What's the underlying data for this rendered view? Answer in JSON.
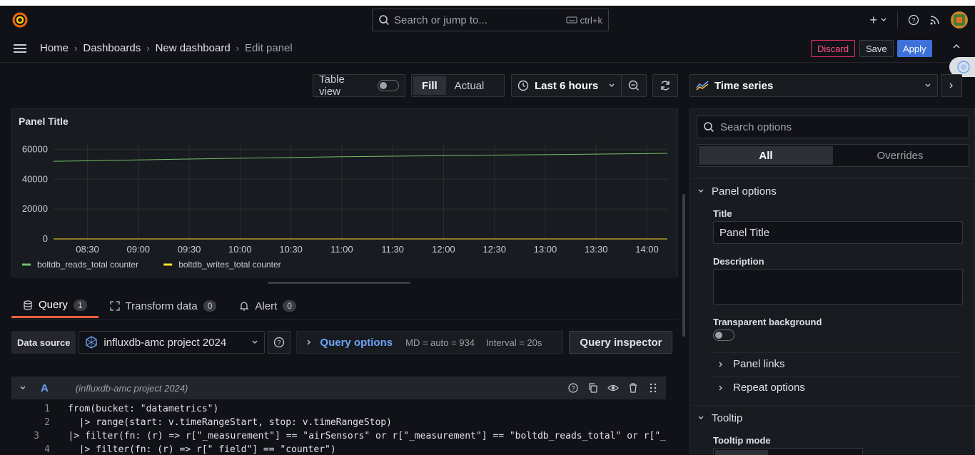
{
  "topbar": {
    "search_placeholder": "Search or jump to...",
    "search_shortcut": "ctrl+k"
  },
  "breadcrumb": {
    "items": [
      "Home",
      "Dashboards",
      "New dashboard"
    ],
    "current": "Edit panel"
  },
  "actions": {
    "discard": "Discard",
    "save": "Save",
    "apply": "Apply"
  },
  "toolbar": {
    "table_view": "Table view",
    "fill": "Fill",
    "actual": "Actual",
    "time_range": "Last 6 hours"
  },
  "panel": {
    "title": "Panel Title"
  },
  "chart_data": {
    "type": "line",
    "title": "Panel Title",
    "x_ticks": [
      "08:30",
      "09:00",
      "09:30",
      "10:00",
      "10:30",
      "11:00",
      "11:30",
      "12:00",
      "12:30",
      "13:00",
      "13:30",
      "14:00"
    ],
    "y_ticks": [
      "0",
      "20000",
      "40000",
      "60000"
    ],
    "ylim": [
      0,
      64000
    ],
    "grid": true,
    "legend_position": "bottom-left",
    "series": [
      {
        "name": "boltdb_reads_total counter",
        "color": "#73bf69",
        "x": [
          "08:10",
          "08:30",
          "09:00",
          "09:30",
          "10:00",
          "10:30",
          "11:00",
          "11:30",
          "12:00",
          "12:30",
          "13:00",
          "13:30",
          "14:00",
          "14:12"
        ],
        "values": [
          52000,
          52300,
          52900,
          53500,
          54000,
          54500,
          55000,
          55400,
          55800,
          56100,
          56400,
          56800,
          57100,
          57300
        ]
      },
      {
        "name": "boltdb_writes_total counter",
        "color": "#fade2a",
        "x": [
          "08:10",
          "14:12"
        ],
        "values": [
          0,
          0
        ]
      }
    ]
  },
  "query_tabs": [
    {
      "label": "Query",
      "count": "1"
    },
    {
      "label": "Transform data",
      "count": "0"
    },
    {
      "label": "Alert",
      "count": "0"
    }
  ],
  "datasource": {
    "label": "Data source",
    "value": "influxdb-amc project 2024",
    "query_options": "Query options",
    "md": "MD = auto = 934",
    "interval": "Interval = 20s",
    "inspector": "Query inspector"
  },
  "query": {
    "ref": "A",
    "source": "(influxdb-amc project 2024)",
    "lines": [
      {
        "n": "1",
        "text": "from(bucket: \"datametrics\")"
      },
      {
        "n": "2",
        "text": "  |> range(start: v.timeRangeStart, stop: v.timeRangeStop)"
      },
      {
        "n": "3",
        "text": "  |> filter(fn: (r) => r[\"_measurement\"] == \"airSensors\" or r[\"_measurement\"] == \"boltdb_reads_total\" or r[\"_"
      },
      {
        "n": "4",
        "text": "  |> filter(fn: (r) => r[\"_field\"] == \"counter\")"
      }
    ]
  },
  "options": {
    "viz": "Time series",
    "search_placeholder": "Search options",
    "seg_all": "All",
    "seg_overrides": "Overrides",
    "panel_options": "Panel options",
    "title_label": "Title",
    "title_value": "Panel Title",
    "description_label": "Description",
    "transparent_label": "Transparent background",
    "panel_links": "Panel links",
    "repeat_options": "Repeat options",
    "tooltip": "Tooltip",
    "tooltip_mode": "Tooltip mode"
  }
}
